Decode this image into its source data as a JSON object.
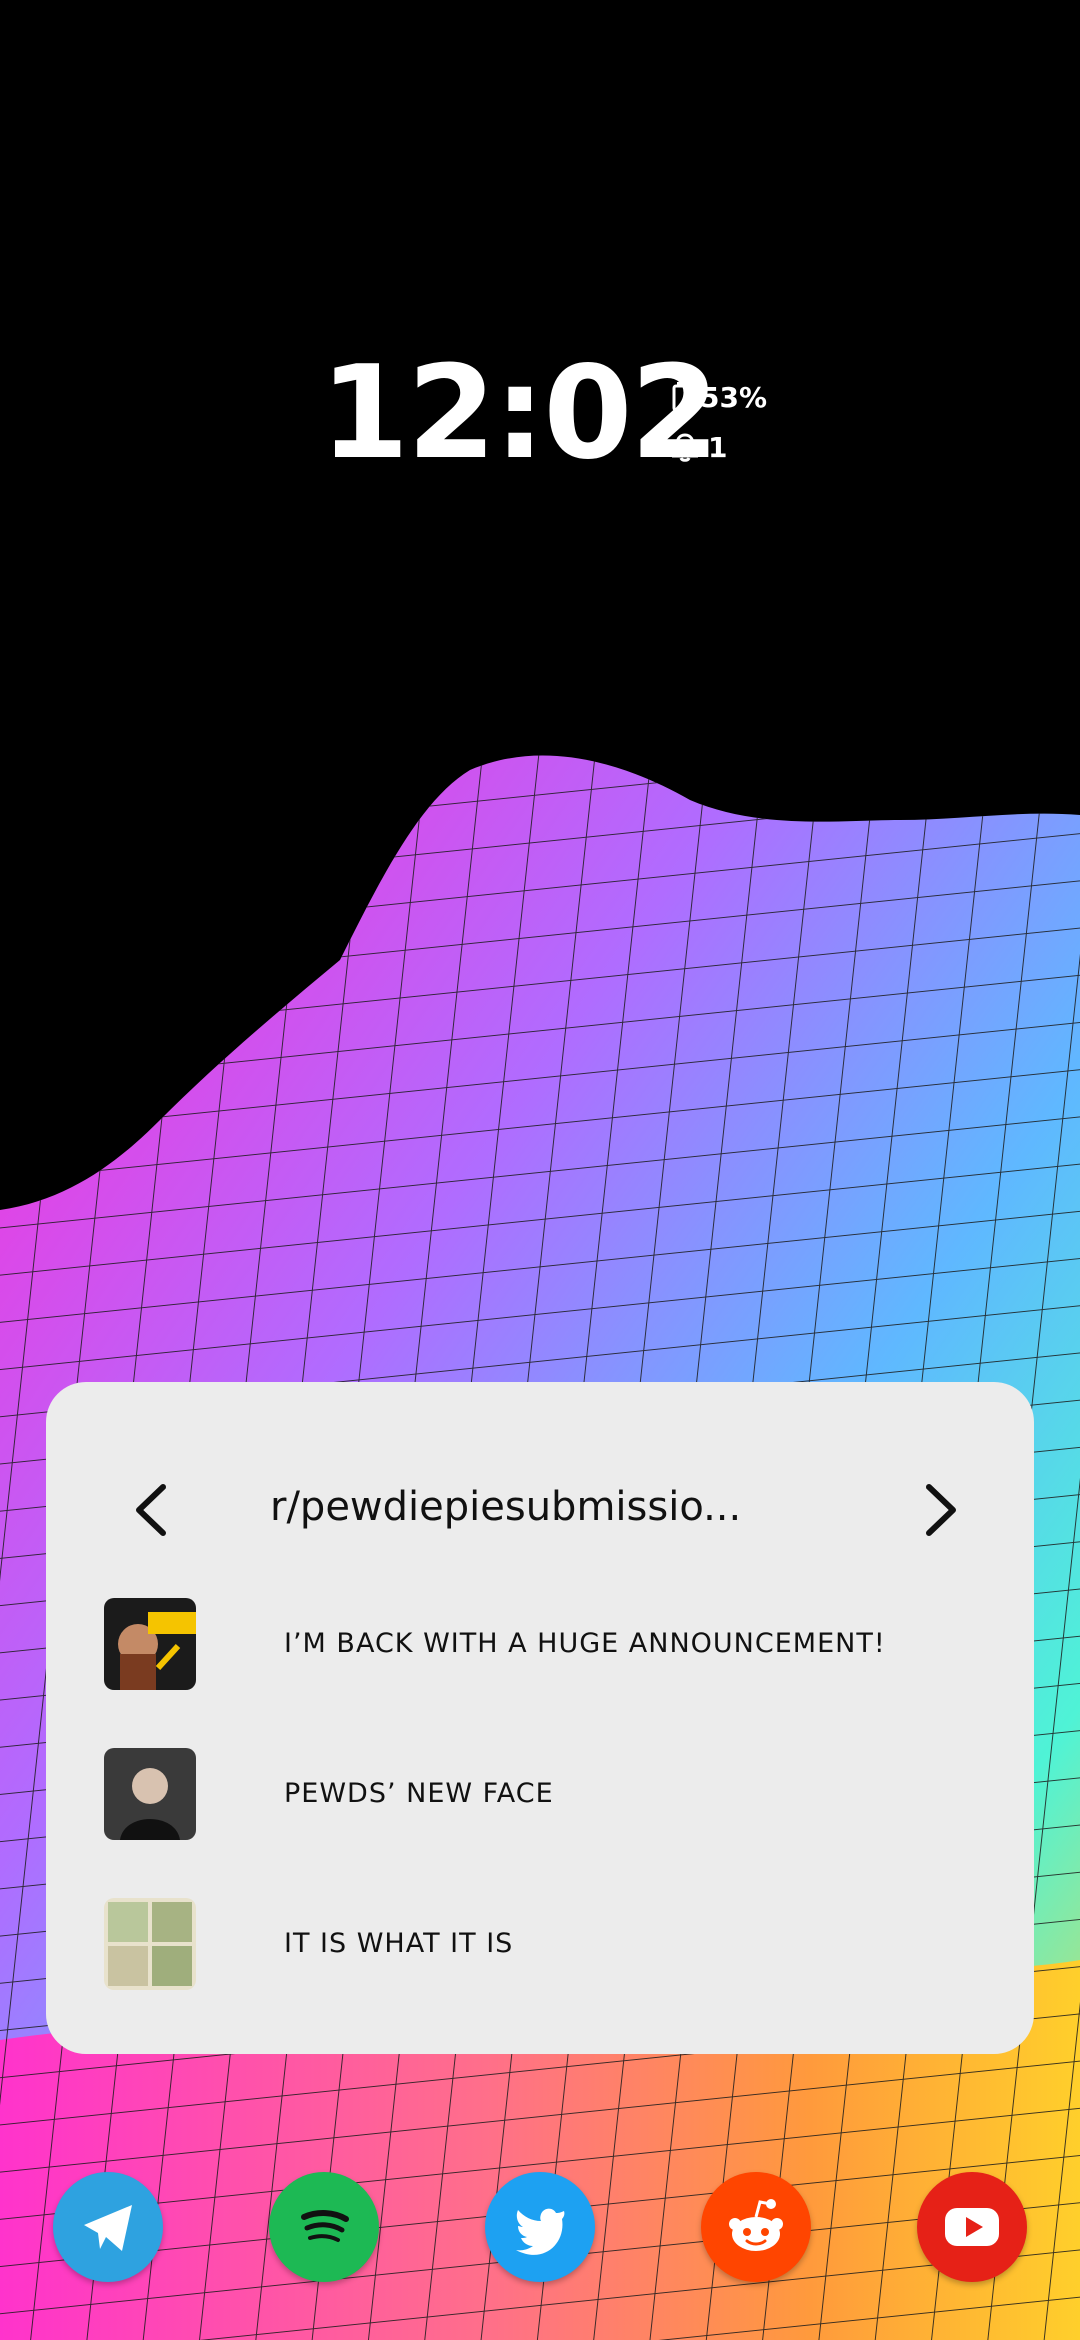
{
  "lockscreen": {
    "time": "12:02",
    "battery": "53%",
    "notifications": "1",
    "battery_icon": "battery-icon",
    "bell_icon": "bell-icon"
  },
  "widget": {
    "subreddit": "r/pewdiepiesubmissio...",
    "prev_icon": "chevron-left-icon",
    "next_icon": "chevron-right-icon",
    "posts": [
      {
        "title": "I’m back with a huge announcement!"
      },
      {
        "title": "PEWDS’ NEW FACE"
      },
      {
        "title": "It is what it is"
      }
    ]
  },
  "dock": {
    "apps": [
      {
        "icon": "telegram-icon",
        "color": "#2ea2e0"
      },
      {
        "icon": "spotify-icon",
        "color": "#1db954"
      },
      {
        "icon": "twitter-icon",
        "color": "#1da1f2"
      },
      {
        "icon": "reddit-icon",
        "color": "#ff4500"
      },
      {
        "icon": "youtube-icon",
        "color": "#e62117"
      }
    ]
  }
}
